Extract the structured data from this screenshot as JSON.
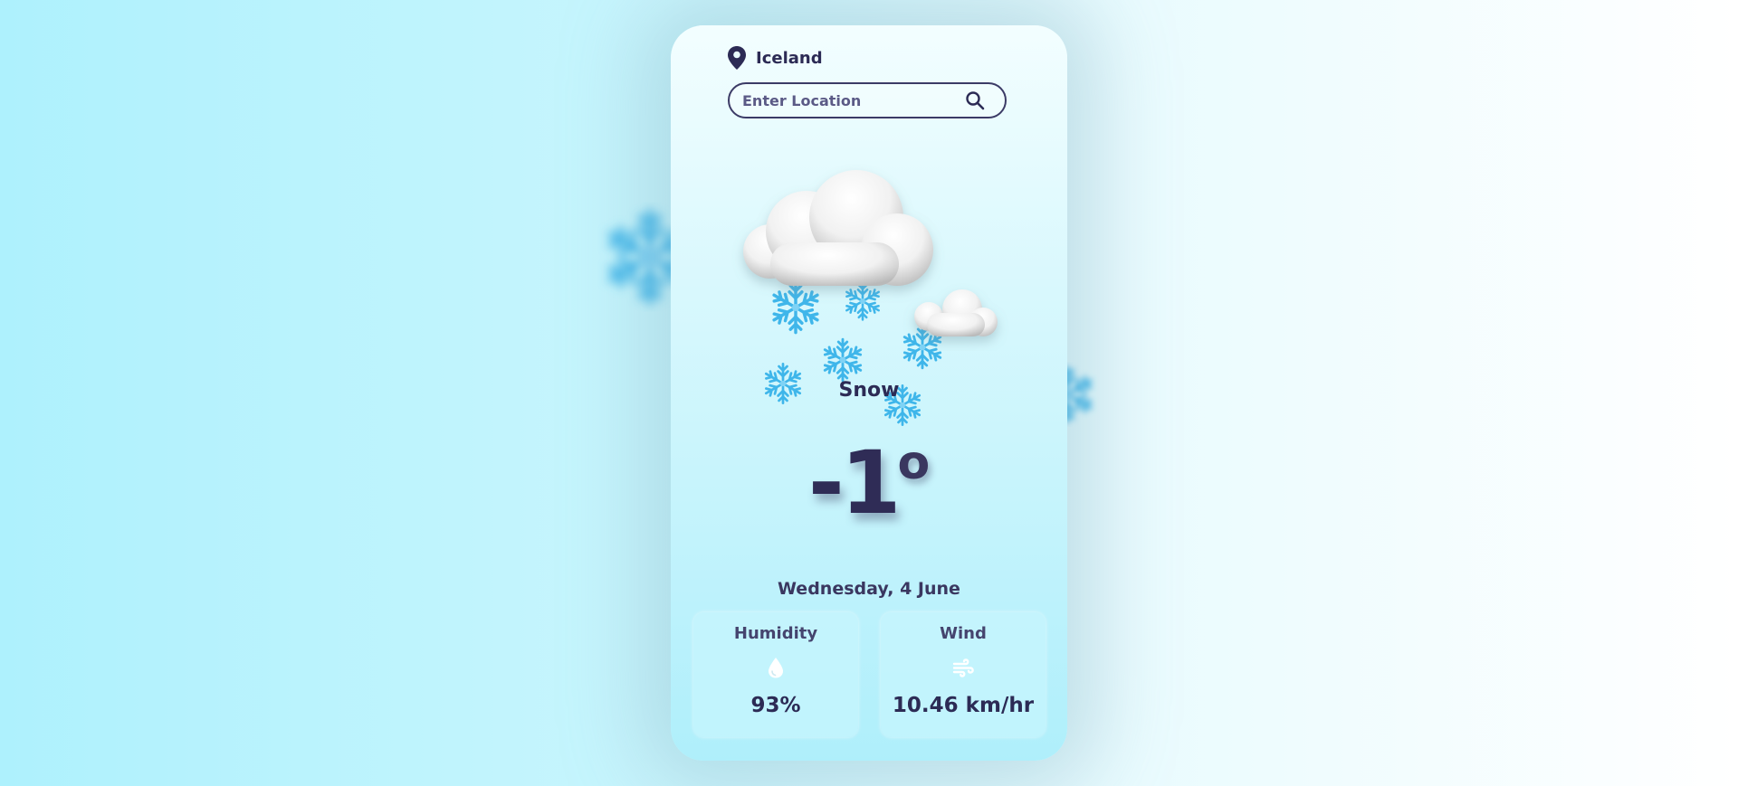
{
  "location": {
    "name": "Iceland",
    "icon": "map-pin-icon"
  },
  "search": {
    "placeholder": "Enter Location",
    "value": "",
    "icon": "search-icon"
  },
  "weather": {
    "condition": "Snow",
    "temperature": "-1",
    "degree_symbol": "o",
    "date": "Wednesday, 4 June",
    "illustration": "cloud-snow-icon"
  },
  "stats": {
    "humidity": {
      "label": "Humidity",
      "value": "93%",
      "icon": "droplet-icon"
    },
    "wind": {
      "label": "Wind",
      "value": "10.46 km/hr",
      "icon": "wind-icon"
    }
  },
  "colors": {
    "text_primary": "#2c2b55",
    "snowflake": "#3fb6ea",
    "card_top": "#f3feff",
    "card_bottom": "#afeffb"
  }
}
